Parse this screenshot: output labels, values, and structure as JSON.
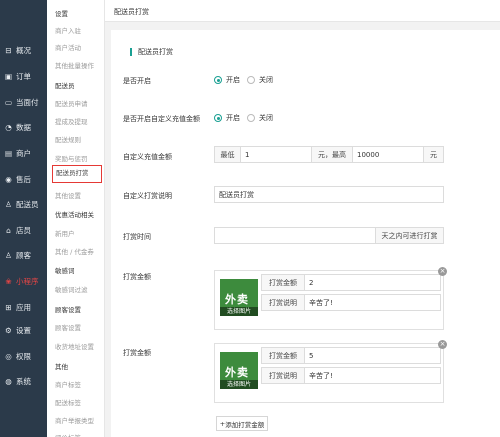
{
  "rail": [
    {
      "icon": "grid-icon",
      "glyph": "⊟",
      "label": "概况",
      "active": false
    },
    {
      "icon": "cart-icon",
      "glyph": "▣",
      "label": "订单",
      "active": false
    },
    {
      "icon": "card-icon",
      "glyph": "▭",
      "label": "当面付",
      "active": false
    },
    {
      "icon": "chart-icon",
      "glyph": "◔",
      "label": "数据",
      "active": false
    },
    {
      "icon": "shop-icon",
      "glyph": "▤",
      "label": "商户",
      "active": false
    },
    {
      "icon": "aftersale-icon",
      "glyph": "◉",
      "label": "售后",
      "active": false
    },
    {
      "icon": "rider-icon",
      "glyph": "♙",
      "label": "配送员",
      "active": false
    },
    {
      "icon": "store-icon",
      "glyph": "⌂",
      "label": "店员",
      "active": false
    },
    {
      "icon": "customer-icon",
      "glyph": "♙",
      "label": "顾客",
      "active": false
    },
    {
      "icon": "mini-program-icon",
      "glyph": "❀",
      "label": "小程序",
      "active": true
    },
    {
      "icon": "apps-icon",
      "glyph": "⊞",
      "label": "应用",
      "active": false
    },
    {
      "icon": "settings-icon",
      "glyph": "⚙",
      "label": "设置",
      "active": false
    },
    {
      "icon": "permission-icon",
      "glyph": "◎",
      "label": "权限",
      "active": false
    },
    {
      "icon": "system-icon",
      "glyph": "◍",
      "label": "系统",
      "active": false
    }
  ],
  "subnav": [
    {
      "label": "设置",
      "type": "head"
    },
    {
      "label": "商户入驻",
      "type": "item"
    },
    {
      "label": "商户活动",
      "type": "item"
    },
    {
      "label": "其他批量操作",
      "type": "item"
    },
    {
      "label": "配送员",
      "type": "head"
    },
    {
      "label": "配送员申请",
      "type": "item"
    },
    {
      "label": "提成及提现",
      "type": "item"
    },
    {
      "label": "配送规则",
      "type": "item"
    },
    {
      "label": "奖励与惩罚",
      "type": "item"
    },
    {
      "label": "配送员打赏",
      "type": "active"
    },
    {
      "label": "其他设置",
      "type": "item"
    },
    {
      "label": "优惠活动相关",
      "type": "head"
    },
    {
      "label": "新用户",
      "type": "item"
    },
    {
      "label": "其他 / 代金券",
      "type": "item"
    },
    {
      "label": "敏感词",
      "type": "head"
    },
    {
      "label": "敏感词过滤",
      "type": "item"
    },
    {
      "label": "顾客设置",
      "type": "head"
    },
    {
      "label": "顾客设置",
      "type": "item"
    },
    {
      "label": "收货地址设置",
      "type": "item"
    },
    {
      "label": "其他",
      "type": "head"
    },
    {
      "label": "商户标签",
      "type": "item"
    },
    {
      "label": "配送标签",
      "type": "item"
    },
    {
      "label": "商户举报类型",
      "type": "item"
    },
    {
      "label": "评价标签",
      "type": "item"
    }
  ],
  "topbar": {
    "title": "配送员打赏"
  },
  "form": {
    "section_title": "配送员打赏",
    "enable": {
      "label": "是否开启",
      "on": "开启",
      "off": "关闭"
    },
    "custom_enable": {
      "label": "是否开启自定义充值金额",
      "on": "开启",
      "off": "关闭"
    },
    "custom_amount": {
      "label": "自定义充值金额",
      "min_label": "最低",
      "min_value": "1",
      "mid_label": "元，最高",
      "max_value": "10000",
      "unit": "元"
    },
    "custom_desc": {
      "label": "自定义打赏说明",
      "value": "配送员打赏"
    },
    "tip_time": {
      "label": "打赏时间",
      "suffix": "天之内可进行打赏"
    },
    "amounts": [
      {
        "label": "打赏金额",
        "img_text": "外卖",
        "img_caption": "选择图片",
        "amount_label": "打赏金额",
        "amount_value": "2",
        "desc_label": "打赏说明",
        "desc_value": "辛苦了!"
      },
      {
        "label": "打赏金额",
        "img_text": "外卖",
        "img_caption": "选择图片",
        "amount_label": "打赏金额",
        "amount_value": "5",
        "desc_label": "打赏说明",
        "desc_value": "辛苦了!"
      }
    ],
    "add_button": "添加打赏金额",
    "close_glyph": "×",
    "add_glyph": "+"
  },
  "colors": {
    "accent": "#1aa093",
    "highlight": "#e53935",
    "rail_bg": "#2b3a4a",
    "active_rail": "#e64545"
  }
}
